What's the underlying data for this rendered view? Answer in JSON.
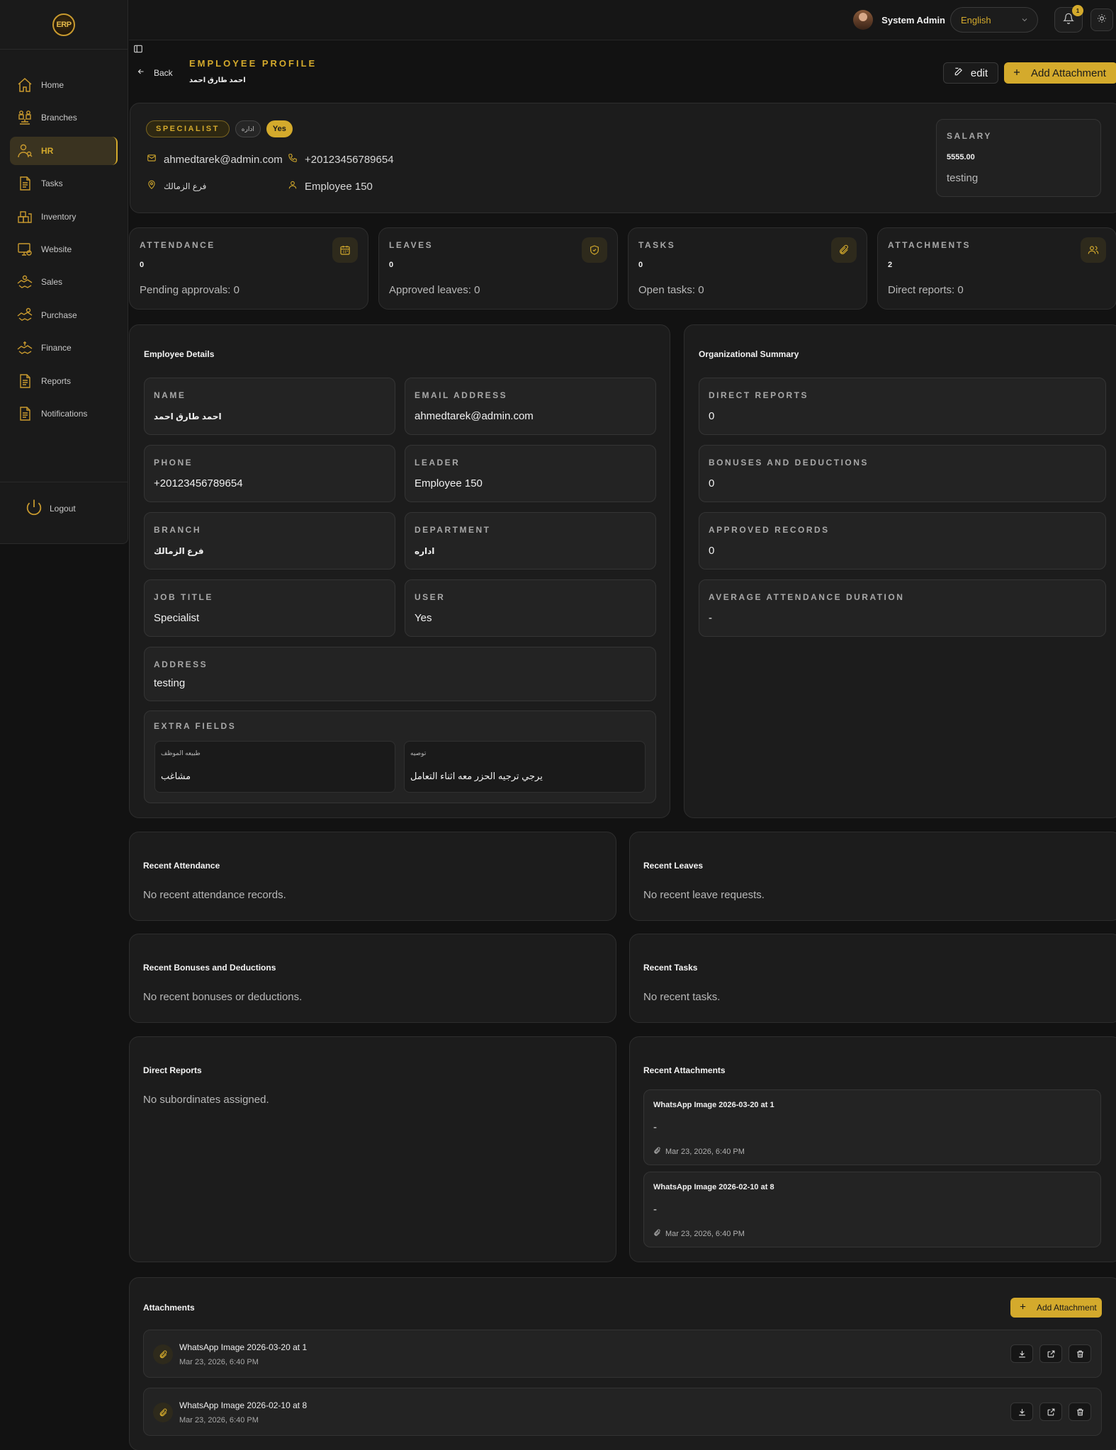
{
  "brand": {
    "logo_text": "ERP"
  },
  "colors": {
    "accent": "#d4aa2c",
    "background": "#121212",
    "card": "#1c1c1c"
  },
  "sidebar": {
    "items": [
      {
        "label": "Home",
        "icon": "home-icon"
      },
      {
        "label": "Branches",
        "icon": "branches-icon"
      },
      {
        "label": "HR",
        "icon": "hr-icon",
        "active": true
      },
      {
        "label": "Tasks",
        "icon": "tasks-icon"
      },
      {
        "label": "Inventory",
        "icon": "inventory-icon"
      },
      {
        "label": "Website",
        "icon": "website-icon"
      },
      {
        "label": "Sales",
        "icon": "sales-icon"
      },
      {
        "label": "Purchase",
        "icon": "purchase-icon"
      },
      {
        "label": "Finance",
        "icon": "finance-icon"
      },
      {
        "label": "Reports",
        "icon": "reports-icon"
      },
      {
        "label": "Notifications",
        "icon": "notifications-icon"
      }
    ],
    "logout_label": "Logout"
  },
  "header": {
    "user_name": "System Admin",
    "language": "English",
    "notification_count": "1"
  },
  "page": {
    "back_label": "Back",
    "title": "EMPLOYEE PROFILE",
    "subtitle": "احمد طارق احمد",
    "edit_label": "edit",
    "add_attachment_label": "Add Attachment"
  },
  "profile": {
    "role_chip": "SPECIALIST",
    "department_chip": "اداره",
    "user_chip": "Yes",
    "email": "ahmedtarek@admin.com",
    "phone": "+20123456789654",
    "branch": "فرع الزمالك",
    "leader": "Employee 150",
    "salary_label": "SALARY",
    "salary_value": "5555.00",
    "salary_note": "testing"
  },
  "stats": [
    {
      "label": "ATTENDANCE",
      "value": "0",
      "sub": "Pending approvals: 0",
      "icon": "calendar-icon"
    },
    {
      "label": "LEAVES",
      "value": "0",
      "sub": "Approved leaves: 0",
      "icon": "shield-check-icon"
    },
    {
      "label": "TASKS",
      "value": "0",
      "sub": "Open tasks: 0",
      "icon": "paperclip-icon"
    },
    {
      "label": "ATTACHMENTS",
      "value": "2",
      "sub": "Direct reports: 0",
      "icon": "users-icon"
    }
  ],
  "details": {
    "title": "Employee Details",
    "fields": [
      {
        "label": "NAME",
        "value": "احمد طارق احمد"
      },
      {
        "label": "EMAIL ADDRESS",
        "value": "ahmedtarek@admin.com"
      },
      {
        "label": "PHONE",
        "value": "+20123456789654"
      },
      {
        "label": "LEADER",
        "value": "Employee 150"
      },
      {
        "label": "BRANCH",
        "value": "فرع الزمالك"
      },
      {
        "label": "DEPARTMENT",
        "value": "اداره"
      },
      {
        "label": "JOB TITLE",
        "value": "Specialist"
      },
      {
        "label": "USER",
        "value": "Yes"
      },
      {
        "label": "ADDRESS",
        "value": "testing"
      }
    ],
    "extra_fields_label": "EXTRA FIELDS",
    "extra_fields": [
      {
        "key": "طبيعه الموظف",
        "value": "مشاغب"
      },
      {
        "key": "توصيه",
        "value": "يرجي ترجيه الحزر معه اثناء التعامل"
      }
    ]
  },
  "org": {
    "title": "Organizational Summary",
    "fields": [
      {
        "label": "DIRECT REPORTS",
        "value": "0"
      },
      {
        "label": "BONUSES AND DEDUCTIONS",
        "value": "0"
      },
      {
        "label": "APPROVED RECORDS",
        "value": "0"
      },
      {
        "label": "AVERAGE ATTENDANCE DURATION",
        "value": "-"
      }
    ]
  },
  "recent": {
    "attendance": {
      "title": "Recent Attendance",
      "empty": "No recent attendance records."
    },
    "leaves": {
      "title": "Recent Leaves",
      "empty": "No recent leave requests."
    },
    "bonuses": {
      "title": "Recent Bonuses and Deductions",
      "empty": "No recent bonuses or deductions."
    },
    "tasks": {
      "title": "Recent Tasks",
      "empty": "No recent tasks."
    },
    "direct_reports": {
      "title": "Direct Reports",
      "empty": "No subordinates assigned."
    },
    "attachments": {
      "title": "Recent Attachments",
      "items": [
        {
          "title": "WhatsApp Image 2026-03-20 at 1",
          "desc": "-",
          "date": "Mar 23, 2026, 6:40 PM"
        },
        {
          "title": "WhatsApp Image 2026-02-10 at 8",
          "desc": "-",
          "date": "Mar 23, 2026, 6:40 PM"
        }
      ]
    }
  },
  "attachments": {
    "title": "Attachments",
    "add_label": "Add Attachment",
    "rows": [
      {
        "name": "WhatsApp Image 2026-03-20 at 1",
        "date": "Mar 23, 2026, 6:40 PM"
      },
      {
        "name": "WhatsApp Image 2026-02-10 at 8",
        "date": "Mar 23, 2026, 6:40 PM"
      }
    ]
  }
}
